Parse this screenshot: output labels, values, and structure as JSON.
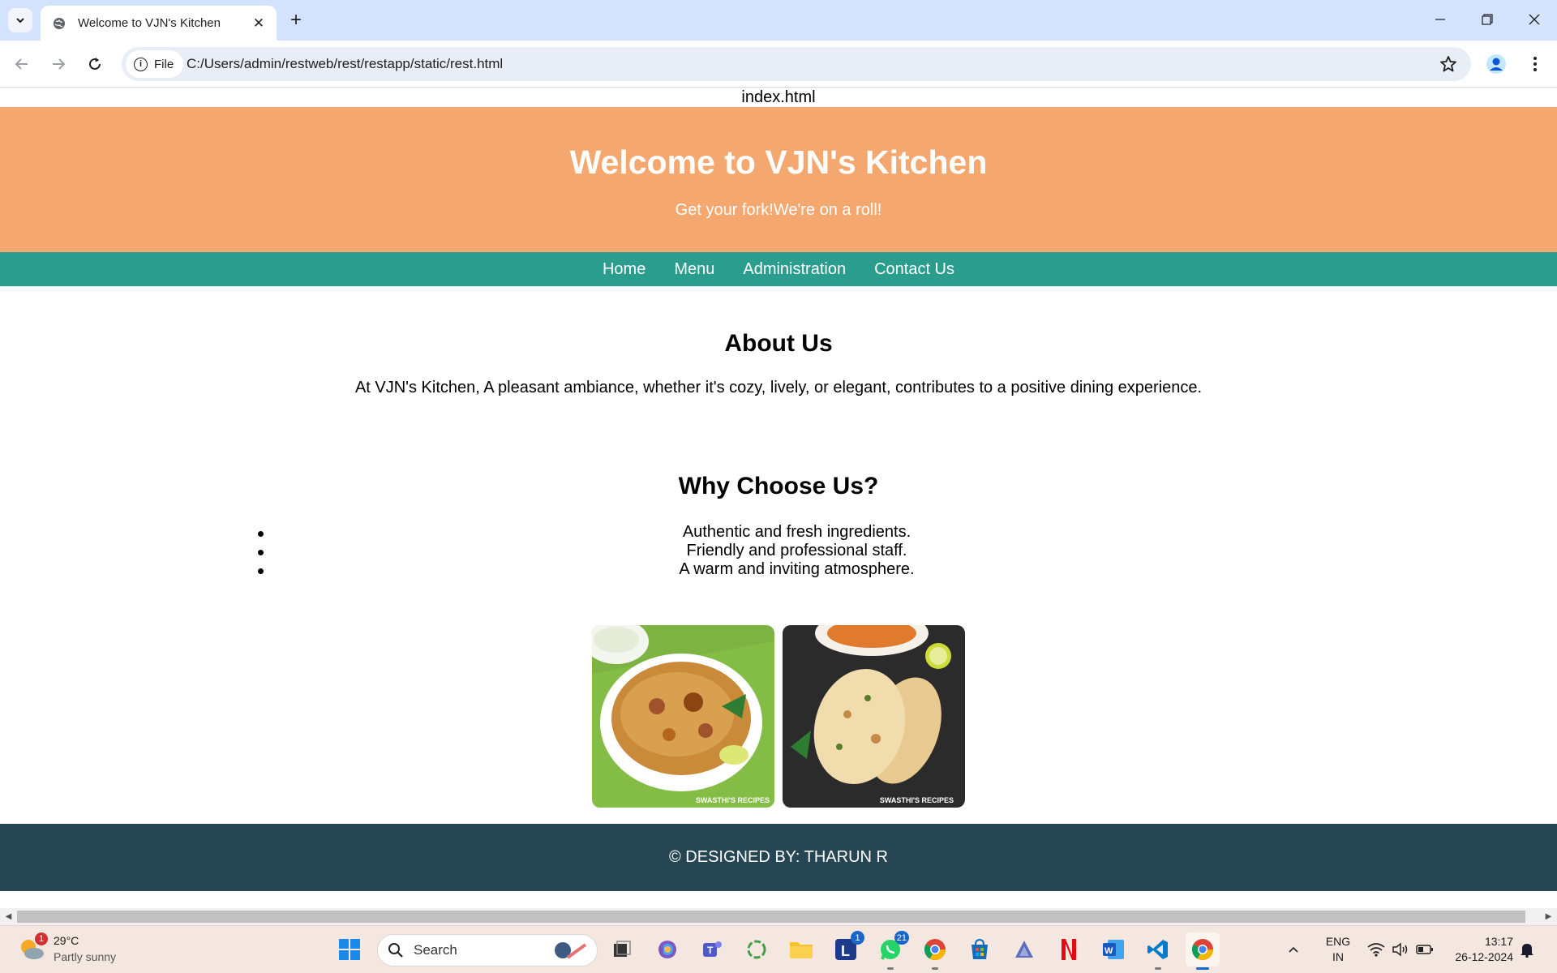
{
  "browser": {
    "tab_title": "Welcome to VJN's Kitchen",
    "file_chip_label": "File",
    "url": "C:/Users/admin/restweb/rest/restapp/static/rest.html"
  },
  "page": {
    "file_label": "index.html",
    "header_title": "Welcome to VJN's Kitchen",
    "header_tagline": "Get your fork!We're on a roll!",
    "nav": [
      "Home",
      "Menu",
      "Administration",
      "Contact Us"
    ],
    "about_title": "About Us",
    "about_text": "At VJN's Kitchen, A pleasant ambiance, whether it's cozy, lively, or elegant, contributes to a positive dining experience.",
    "why_title": "Why Choose Us?",
    "why_items": [
      "Authentic and fresh ingredients.",
      "Friendly and professional staff.",
      "A warm and inviting atmosphere."
    ],
    "image_watermark": "SWASTHI'S RECIPES",
    "footer": "© DESIGNED BY: THARUN R",
    "colors": {
      "header_bg": "#f4a86f",
      "nav_bg": "#2a9d8f",
      "footer_bg": "#264653"
    }
  },
  "taskbar": {
    "weather_temp": "29°C",
    "weather_desc": "Partly sunny",
    "weather_badge": "1",
    "search_placeholder": "Search",
    "badge_l": "1",
    "badge_whatsapp": "21",
    "lang_1": "ENG",
    "lang_2": "IN",
    "time": "13:17",
    "date": "26-12-2024"
  }
}
